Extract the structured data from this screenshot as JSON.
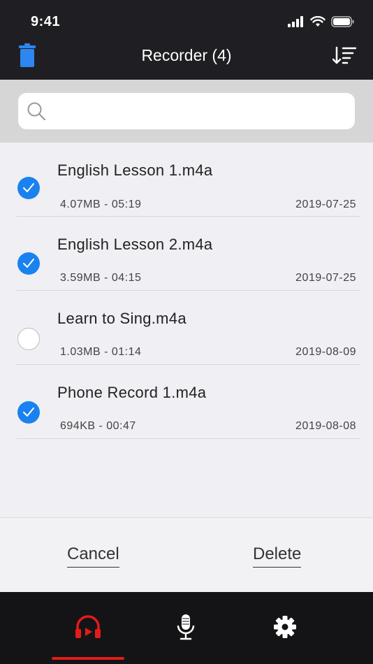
{
  "status_bar": {
    "time": "9:41"
  },
  "nav": {
    "title": "Recorder (4)"
  },
  "search": {
    "placeholder": "",
    "value": ""
  },
  "recordings": [
    {
      "name": "English Lesson 1.m4a",
      "meta": "4.07MB - 05:19",
      "date": "2019-07-25",
      "selected": true
    },
    {
      "name": "English Lesson 2.m4a",
      "meta": "3.59MB - 04:15",
      "date": "2019-07-25",
      "selected": true
    },
    {
      "name": "Learn to Sing.m4a",
      "meta": "1.03MB - 01:14",
      "date": "2019-08-09",
      "selected": false
    },
    {
      "name": "Phone Record 1.m4a",
      "meta": "694KB - 00:47",
      "date": "2019-08-08",
      "selected": true
    }
  ],
  "actions": {
    "cancel_label": "Cancel",
    "delete_label": "Delete"
  },
  "tabs": [
    {
      "icon": "headphones-play-icon",
      "active": true
    },
    {
      "icon": "microphone-icon",
      "active": false
    },
    {
      "icon": "gear-icon",
      "active": false
    }
  ],
  "colors": {
    "accent": "#1a82f0",
    "active_tab": "#e21b1b",
    "bar_bg": "#1f1f23"
  }
}
